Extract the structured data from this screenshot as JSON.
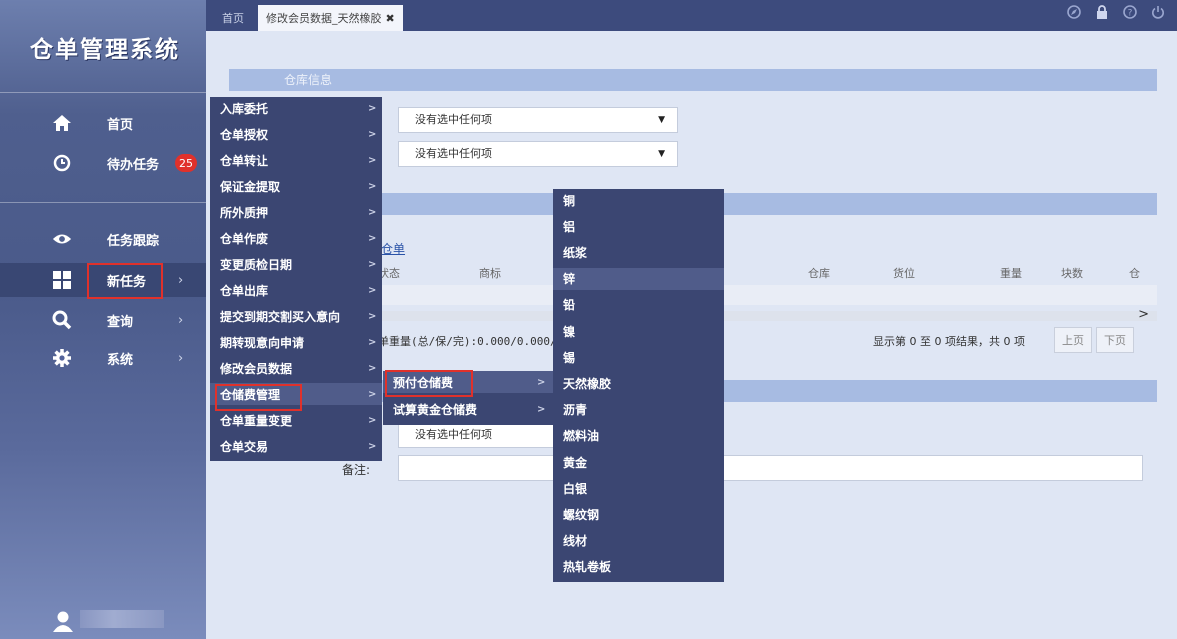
{
  "app": {
    "title": "仓单管理系统"
  },
  "tabs": {
    "home": "首页",
    "active": "修改会员数据_天然橡胶",
    "close": "✖"
  },
  "top_icons": [
    "compass-icon",
    "lock-icon",
    "help-icon",
    "power-icon"
  ],
  "sidebar": {
    "items": [
      {
        "label": "首页",
        "icon": "home-icon"
      },
      {
        "label": "待办任务",
        "icon": "clock-icon",
        "badge": "25"
      },
      {
        "label": "任务跟踪",
        "icon": "eye-icon"
      },
      {
        "label": "新任务",
        "icon": "grid-icon",
        "chevron": "›"
      },
      {
        "label": "查询",
        "icon": "search-icon",
        "chevron": "›"
      },
      {
        "label": "系统",
        "icon": "gear-icon",
        "chevron": "›"
      }
    ]
  },
  "main": {
    "section1_title": "仓库信息",
    "select1": "没有选中任何项",
    "select2": "没有选中任何项",
    "list_link": "仓单",
    "table_headers": [
      "状态",
      "商标",
      "仓库",
      "货位",
      "重量",
      "块数",
      "仓"
    ],
    "summary_weight": "单重量(总/保/完):0.000/0.000/0.",
    "pager_info": "显示第 0 至 0 项结果，共 0 项",
    "prev": "上页",
    "next": "下页",
    "select3": "没有选中任何项",
    "remark_label": "备注:"
  },
  "menu_level1": [
    "入库委托",
    "仓单授权",
    "仓单转让",
    "保证金提取",
    "所外质押",
    "仓单作废",
    "变更质检日期",
    "仓单出库",
    "提交到期交割买入意向",
    "期转现意向申请",
    "修改会员数据",
    "仓储费管理",
    "仓单重量变更",
    "仓单交易"
  ],
  "menu_level2": [
    "预付仓储费",
    "试算黄金仓储费"
  ],
  "menu_level3": [
    "铜",
    "铝",
    "纸浆",
    "锌",
    "铅",
    "镍",
    "锡",
    "天然橡胶",
    "沥青",
    "燃料油",
    "黄金",
    "白银",
    "螺纹钢",
    "线材",
    "热轧卷板"
  ],
  "chevron": ">"
}
